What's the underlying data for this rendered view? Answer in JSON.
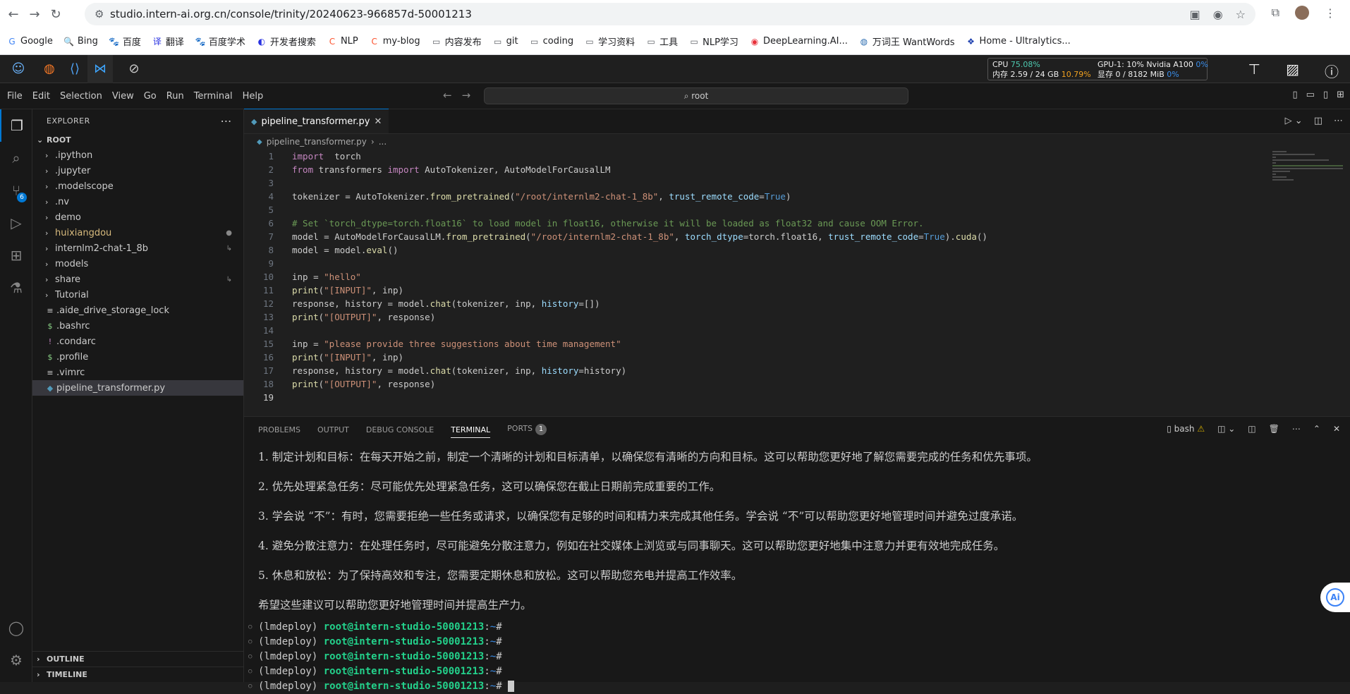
{
  "browser": {
    "url": "studio.intern-ai.org.cn/console/trinity/20240623-966857d-50001213",
    "bookmarks": [
      {
        "label": "Google",
        "icon": "G",
        "color": "#4285f4"
      },
      {
        "label": "Bing",
        "icon": "🔍",
        "color": "#5f6368"
      },
      {
        "label": "百度",
        "icon": "🐾",
        "color": "#2932e1"
      },
      {
        "label": "翻译",
        "icon": "译",
        "color": "#2932e1"
      },
      {
        "label": "百度学术",
        "icon": "🐾",
        "color": "#2932e1"
      },
      {
        "label": "开发者搜索",
        "icon": "◐",
        "color": "#2932e1"
      },
      {
        "label": "NLP",
        "icon": "C",
        "color": "#fc5531"
      },
      {
        "label": "my-blog",
        "icon": "C",
        "color": "#fc5531"
      },
      {
        "label": "内容发布",
        "icon": "▭",
        "color": "#5f6368"
      },
      {
        "label": "git",
        "icon": "▭",
        "color": "#5f6368"
      },
      {
        "label": "coding",
        "icon": "▭",
        "color": "#5f6368"
      },
      {
        "label": "学习资料",
        "icon": "▭",
        "color": "#5f6368"
      },
      {
        "label": "工具",
        "icon": "▭",
        "color": "#5f6368"
      },
      {
        "label": "NLP学习",
        "icon": "▭",
        "color": "#5f6368"
      },
      {
        "label": "DeepLearning.AI...",
        "icon": "◉",
        "color": "#e8313b"
      },
      {
        "label": "万词王 WantWords",
        "icon": "◍",
        "color": "#2b6cb0"
      },
      {
        "label": "Home - Ultralytics...",
        "icon": "❖",
        "color": "#1e40af"
      }
    ]
  },
  "studio": {
    "cpu_label": "CPU",
    "cpu_value": "75.08%",
    "mem_label": "内存 2.59 / 24 GB",
    "mem_value": "10.79%",
    "gpu_label": "GPU-1: 10% Nvidia A100",
    "gpu_value": "0%",
    "vram_label": "显存 0 / 8182 MiB",
    "vram_value": "0%"
  },
  "menu": [
    "File",
    "Edit",
    "Selection",
    "View",
    "Go",
    "Run",
    "Terminal",
    "Help"
  ],
  "command_center": "root",
  "explorer": {
    "title": "EXPLORER",
    "root": "ROOT",
    "items": [
      {
        "label": ".ipython",
        "type": "folder",
        "color": "#ccc"
      },
      {
        "label": ".jupyter",
        "type": "folder",
        "color": "#ccc"
      },
      {
        "label": ".modelscope",
        "type": "folder",
        "color": "#ccc"
      },
      {
        "label": ".nv",
        "type": "folder",
        "color": "#ccc"
      },
      {
        "label": "demo",
        "type": "folder",
        "color": "#ccc"
      },
      {
        "label": "huixiangdou",
        "type": "folder",
        "color": "#d7ba7d",
        "dec": "●"
      },
      {
        "label": "internlm2-chat-1_8b",
        "type": "folder",
        "color": "#ccc",
        "dec": "↳"
      },
      {
        "label": "models",
        "type": "folder",
        "color": "#ccc"
      },
      {
        "label": "share",
        "type": "folder",
        "color": "#ccc",
        "dec": "↳"
      },
      {
        "label": "Tutorial",
        "type": "folder",
        "color": "#ccc"
      },
      {
        "label": ".aide_drive_storage_lock",
        "type": "file",
        "icon": "≡",
        "icolor": "#ccc"
      },
      {
        "label": ".bashrc",
        "type": "file",
        "icon": "$",
        "icolor": "#89d185"
      },
      {
        "label": ".condarc",
        "type": "file",
        "icon": "!",
        "icolor": "#c586c0"
      },
      {
        "label": ".profile",
        "type": "file",
        "icon": "$",
        "icolor": "#89d185"
      },
      {
        "label": ".vimrc",
        "type": "file",
        "icon": "≡",
        "icolor": "#ccc"
      },
      {
        "label": "pipeline_transformer.py",
        "type": "file",
        "icon": "◆",
        "icolor": "#519aba",
        "selected": true
      }
    ],
    "outline": "OUTLINE",
    "timeline": "TIMELINE"
  },
  "editor": {
    "tab": "pipeline_transformer.py",
    "breadcrumb": "pipeline_transformer.py",
    "breadcrumb_more": "...",
    "lines": [
      [
        [
          "kw",
          "import"
        ],
        [
          "",
          "  torch"
        ]
      ],
      [
        [
          "kw",
          "from"
        ],
        [
          "",
          " transformers "
        ],
        [
          "kw",
          "import"
        ],
        [
          "",
          " AutoTokenizer, AutoModelForCausalLM"
        ]
      ],
      [],
      [
        [
          "",
          "tokenizer = AutoTokenizer."
        ],
        [
          "fn",
          "from_pretrained"
        ],
        [
          "",
          "("
        ],
        [
          "str",
          "\"/root/internlm2-chat-1_8b\""
        ],
        [
          "",
          ", "
        ],
        [
          "var",
          "trust_remote_code"
        ],
        [
          "",
          "="
        ],
        [
          "num",
          "True"
        ],
        [
          "",
          ")"
        ]
      ],
      [],
      [
        [
          "com",
          "# Set `torch_dtype=torch.float16` to load model in float16, otherwise it will be loaded as float32 and cause OOM Error."
        ]
      ],
      [
        [
          "",
          "model = AutoModelForCausalLM."
        ],
        [
          "fn",
          "from_pretrained"
        ],
        [
          "",
          "("
        ],
        [
          "str",
          "\"/root/internlm2-chat-1_8b\""
        ],
        [
          "",
          ", "
        ],
        [
          "var",
          "torch_dtype"
        ],
        [
          "",
          "=torch.float16, "
        ],
        [
          "var",
          "trust_remote_code"
        ],
        [
          "",
          "="
        ],
        [
          "num",
          "True"
        ],
        [
          "",
          ")."
        ],
        [
          "fn",
          "cuda"
        ],
        [
          "",
          "()"
        ]
      ],
      [
        [
          "",
          "model = model."
        ],
        [
          "fn",
          "eval"
        ],
        [
          "",
          "()"
        ]
      ],
      [],
      [
        [
          "",
          "inp = "
        ],
        [
          "str",
          "\"hello\""
        ]
      ],
      [
        [
          "fn",
          "print"
        ],
        [
          "",
          "("
        ],
        [
          "str",
          "\"[INPUT]\""
        ],
        [
          "",
          ", inp)"
        ]
      ],
      [
        [
          "",
          "response, history = model."
        ],
        [
          "fn",
          "chat"
        ],
        [
          "",
          "(tokenizer, inp, "
        ],
        [
          "var",
          "history"
        ],
        [
          "",
          "=[])"
        ]
      ],
      [
        [
          "fn",
          "print"
        ],
        [
          "",
          "("
        ],
        [
          "str",
          "\"[OUTPUT]\""
        ],
        [
          "",
          ", response)"
        ]
      ],
      [],
      [
        [
          "",
          "inp = "
        ],
        [
          "str",
          "\"please provide three suggestions about time management\""
        ]
      ],
      [
        [
          "fn",
          "print"
        ],
        [
          "",
          "("
        ],
        [
          "str",
          "\"[INPUT]\""
        ],
        [
          "",
          ", inp)"
        ]
      ],
      [
        [
          "",
          "response, history = model."
        ],
        [
          "fn",
          "chat"
        ],
        [
          "",
          "(tokenizer, inp, "
        ],
        [
          "var",
          "history"
        ],
        [
          "",
          "=history)"
        ]
      ],
      [
        [
          "fn",
          "print"
        ],
        [
          "",
          "("
        ],
        [
          "str",
          "\"[OUTPUT]\""
        ],
        [
          "",
          ", response)"
        ]
      ],
      []
    ]
  },
  "panel": {
    "tabs": [
      "PROBLEMS",
      "OUTPUT",
      "DEBUG CONSOLE",
      "TERMINAL",
      "PORTS"
    ],
    "ports_count": "1",
    "shell": "bash",
    "output": [
      "1. 制定计划和目标：在每天开始之前，制定一个清晰的计划和目标清单，以确保您有清晰的方向和目标。这可以帮助您更好地了解您需要完成的任务和优先事项。",
      "2. 优先处理紧急任务：尽可能优先处理紧急任务，这可以确保您在截止日期前完成重要的工作。",
      "3. 学会说 “不”：有时，您需要拒绝一些任务或请求，以确保您有足够的时间和精力来完成其他任务。学会说 “不”可以帮助您更好地管理时间并避免过度承诺。",
      "4. 避免分散注意力：在处理任务时，尽可能避免分散注意力，例如在社交媒体上浏览或与同事聊天。这可以帮助您更好地集中注意力并更有效地完成任务。",
      "5. 休息和放松：为了保持高效和专注，您需要定期休息和放松。这可以帮助您充电并提高工作效率。",
      "希望这些建议可以帮助您更好地管理时间并提高生产力。"
    ],
    "prompt_env": "(lmdeploy)",
    "prompt_user": "root@intern-studio-50001213",
    "prompt_path": "~",
    "prompt_sym": "#",
    "prompt_count": 5
  },
  "ai_button": "Ai"
}
